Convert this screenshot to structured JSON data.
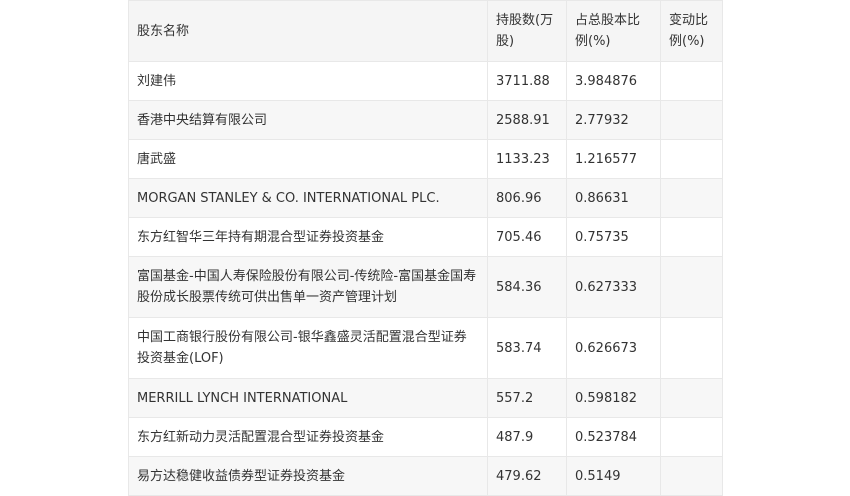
{
  "table": {
    "headers": [
      "股东名称",
      "持股数(万股)",
      "占总股本比例(%)",
      "变动比例(%)"
    ],
    "rows": [
      [
        "刘建伟",
        "3711.88",
        "3.984876",
        ""
      ],
      [
        "香港中央结算有限公司",
        "2588.91",
        "2.77932",
        ""
      ],
      [
        "唐武盛",
        "1133.23",
        "1.216577",
        ""
      ],
      [
        "MORGAN STANLEY & CO. INTERNATIONAL PLC.",
        "806.96",
        "0.86631",
        ""
      ],
      [
        "东方红智华三年持有期混合型证券投资基金",
        "705.46",
        "0.75735",
        ""
      ],
      [
        "富国基金-中国人寿保险股份有限公司-传统险-富国基金国寿股份成长股票传统可供出售单一资产管理计划",
        "584.36",
        "0.627333",
        ""
      ],
      [
        "中国工商银行股份有限公司-银华鑫盛灵活配置混合型证券投资基金(LOF)",
        "583.74",
        "0.626673",
        ""
      ],
      [
        "MERRILL LYNCH INTERNATIONAL",
        "557.2",
        "0.598182",
        ""
      ],
      [
        "东方红新动力灵活配置混合型证券投资基金",
        "487.9",
        "0.523784",
        ""
      ],
      [
        "易方达稳健收益债券型证券投资基金",
        "479.62",
        "0.5149",
        ""
      ]
    ]
  }
}
